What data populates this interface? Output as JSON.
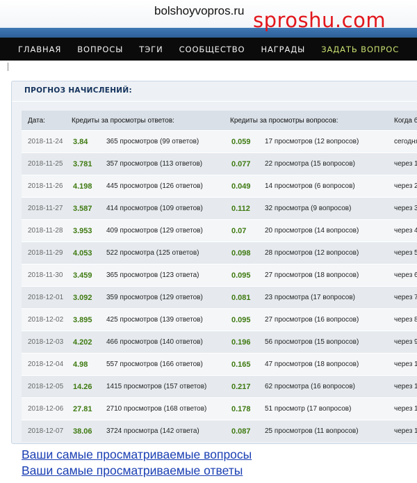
{
  "header": {
    "domain": "bolshoyvopros.ru",
    "watermark": "sproshu.com"
  },
  "nav": {
    "items": [
      {
        "label": "ГЛАВНАЯ"
      },
      {
        "label": "ВОПРОСЫ"
      },
      {
        "label": "ТЭГИ"
      },
      {
        "label": "СООБЩЕСТВО"
      },
      {
        "label": "НАГРАДЫ"
      },
      {
        "label": "ЗАДАТЬ ВОПРОС"
      }
    ]
  },
  "panel": {
    "title": "ПРОГНОЗ НАЧИСЛЕНИЙ:",
    "columns": {
      "date": "Дата:",
      "answers_credit": "Кредиты за просмотры ответов:",
      "questions_credit": "Кредиты за просмотры вопросов:",
      "when": "Когда бу"
    },
    "rows": [
      {
        "date": "2018-11-24",
        "a_credit": "3.84",
        "a_views": "365 просмотров (99 ответов)",
        "q_credit": "0.059",
        "q_views": "17 просмотров (12 вопросов)",
        "when": "сегодня"
      },
      {
        "date": "2018-11-25",
        "a_credit": "3.781",
        "a_views": "357 просмотров (113 ответов)",
        "q_credit": "0.077",
        "q_views": "22 просмотра (15 вопросов)",
        "when": "через 1"
      },
      {
        "date": "2018-11-26",
        "a_credit": "4.198",
        "a_views": "445 просмотров (126 ответов)",
        "q_credit": "0.049",
        "q_views": "14 просмотров (6 вопросов)",
        "when": "через 2"
      },
      {
        "date": "2018-11-27",
        "a_credit": "3.587",
        "a_views": "414 просмотров (109 ответов)",
        "q_credit": "0.112",
        "q_views": "32 просмотра (9 вопросов)",
        "when": "через 3"
      },
      {
        "date": "2018-11-28",
        "a_credit": "3.953",
        "a_views": "409 просмотров (129 ответов)",
        "q_credit": "0.07",
        "q_views": "20 просмотров (14 вопросов)",
        "when": "через 4"
      },
      {
        "date": "2018-11-29",
        "a_credit": "4.053",
        "a_views": "522 просмотра (125 ответов)",
        "q_credit": "0.098",
        "q_views": "28 просмотров (12 вопросов)",
        "when": "через 5"
      },
      {
        "date": "2018-11-30",
        "a_credit": "3.459",
        "a_views": "365 просмотров (123 ответа)",
        "q_credit": "0.095",
        "q_views": "27 просмотров (18 вопросов)",
        "when": "через 6"
      },
      {
        "date": "2018-12-01",
        "a_credit": "3.092",
        "a_views": "359 просмотров (129 ответов)",
        "q_credit": "0.081",
        "q_views": "23 просмотра (17 вопросов)",
        "when": "через 7"
      },
      {
        "date": "2018-12-02",
        "a_credit": "3.895",
        "a_views": "425 просмотров (139 ответов)",
        "q_credit": "0.095",
        "q_views": "27 просмотров (16 вопросов)",
        "when": "через 8"
      },
      {
        "date": "2018-12-03",
        "a_credit": "4.202",
        "a_views": "466 просмотров (140 ответов)",
        "q_credit": "0.196",
        "q_views": "56 просмотров (15 вопросов)",
        "when": "через 9"
      },
      {
        "date": "2018-12-04",
        "a_credit": "4.98",
        "a_views": "557 просмотров (166 ответов)",
        "q_credit": "0.165",
        "q_views": "47 просмотров (18 вопросов)",
        "when": "через 1"
      },
      {
        "date": "2018-12-05",
        "a_credit": "14.26",
        "a_views": "1415 просмотров (157 ответов)",
        "q_credit": "0.217",
        "q_views": "62 просмотра (16 вопросов)",
        "when": "через 1"
      },
      {
        "date": "2018-12-06",
        "a_credit": "27.81",
        "a_views": "2710 просмотров (168 ответов)",
        "q_credit": "0.178",
        "q_views": "51 просмотр (17 вопросов)",
        "when": "через 1"
      },
      {
        "date": "2018-12-07",
        "a_credit": "38.06",
        "a_views": "3724 просмотра (142 ответа)",
        "q_credit": "0.087",
        "q_views": "25 просмотров (11 вопросов)",
        "when": "через 1"
      }
    ]
  },
  "links": {
    "top_questions": "Ваши самые просматриваемые вопросы",
    "top_answers": "Ваши самые просматриваемые ответы"
  }
}
